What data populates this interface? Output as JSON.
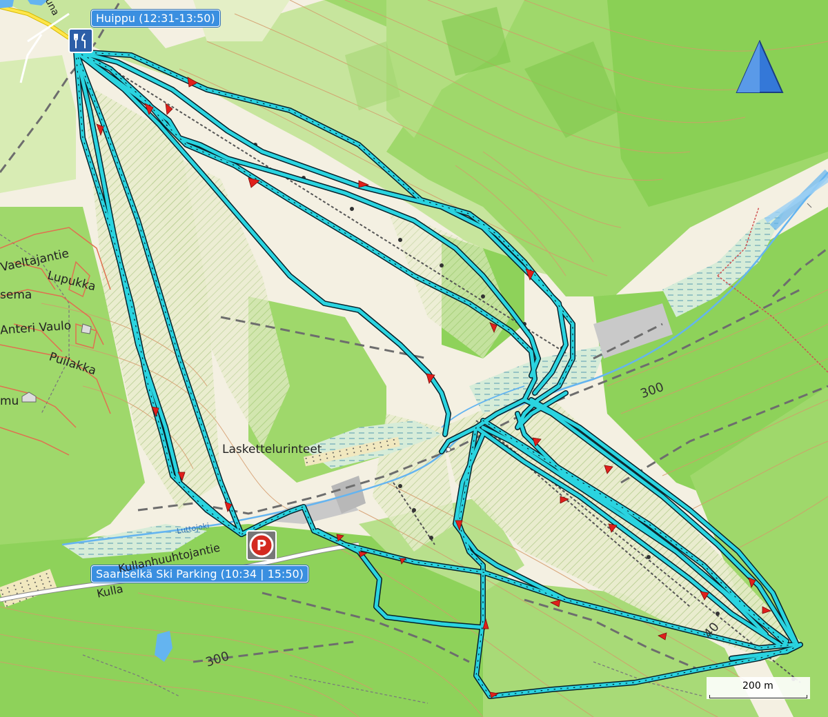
{
  "map": {
    "north_arrow_icon": "north-arrow-icon",
    "scale_bar": {
      "label": "200 m"
    },
    "waypoints": [
      {
        "id": "summit",
        "label": "Huippu (12:31-13:50)",
        "icon": "restaurant-icon"
      },
      {
        "id": "parking",
        "label": "Saariselkä Ski Parking (10:34 | 15:50)",
        "icon": "parking-icon"
      }
    ],
    "place_labels": [
      {
        "id": "vaeltajantie",
        "text": "Vaeltajantie"
      },
      {
        "id": "lupukka",
        "text": "Lupukka"
      },
      {
        "id": "sema",
        "text": "sema"
      },
      {
        "id": "anteri-vaulo",
        "text": "Anteri  Vaulo"
      },
      {
        "id": "puilakka",
        "text": "Puilakka"
      },
      {
        "id": "mu",
        "text": "mu"
      },
      {
        "id": "laskettelurinteet",
        "text": "Laskettelurinteet"
      },
      {
        "id": "luttojoki",
        "text": "Luttojoki"
      },
      {
        "id": "kullanhuuhtojantie",
        "text": "Kullanhuuhtojantie"
      },
      {
        "id": "kulla",
        "text": "Kulla"
      },
      {
        "id": "una",
        "text": "una"
      }
    ],
    "contour_labels": [
      {
        "id": "c300-east",
        "text": "300"
      },
      {
        "id": "c300-south",
        "text": "300"
      },
      {
        "id": "c400",
        "text": "40"
      }
    ],
    "colors": {
      "track": "#2ad4e0",
      "track_outline": "#06202a",
      "arrow": "#e0201c",
      "forest": "#8ed25a",
      "forest_light": "#c6e79c",
      "background": "#f4f0e2",
      "contour": "#d49a6a",
      "water": "#64b4f0",
      "callout": "#3a8fe0"
    }
  }
}
